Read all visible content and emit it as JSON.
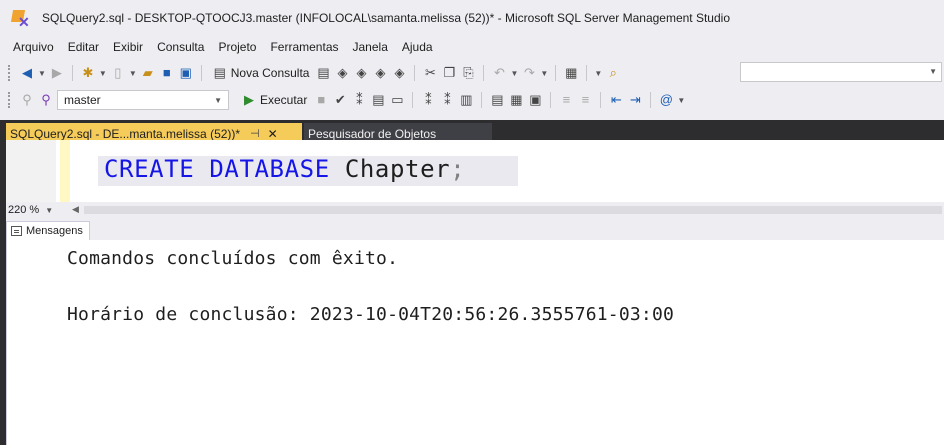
{
  "window": {
    "title": "SQLQuery2.sql - DESKTOP-QTOOCJ3.master (INFOLOCAL\\samanta.melissa (52))* - Microsoft SQL Server Management Studio"
  },
  "menu": [
    "Arquivo",
    "Editar",
    "Exibir",
    "Consulta",
    "Projeto",
    "Ferramentas",
    "Janela",
    "Ajuda"
  ],
  "toolbar1": {
    "new_query_label": "Nova Consulta"
  },
  "toolbar2": {
    "database": "master",
    "execute_label": "Executar"
  },
  "tabs": {
    "active": "SQLQuery2.sql - DE...manta.melissa (52))*",
    "pin_symbol": "⊣",
    "close_symbol": "✕",
    "inactive": "Pesquisador de Objetos"
  },
  "editor": {
    "keyword1": "CREATE",
    "keyword2": "DATABASE",
    "identifier": "Chapter",
    "terminator": ";"
  },
  "status": {
    "zoom": "220 %"
  },
  "results": {
    "tab_label": "Mensagens",
    "line1": "Comandos concluídos com êxito.",
    "line2": "Horário de conclusão: 2023-10-04T20:56:26.3555761-03:00"
  },
  "colors": {
    "active_tab": "#f5cc5a",
    "dark_chrome": "#2d2d30",
    "keyword": "#1515e8"
  }
}
